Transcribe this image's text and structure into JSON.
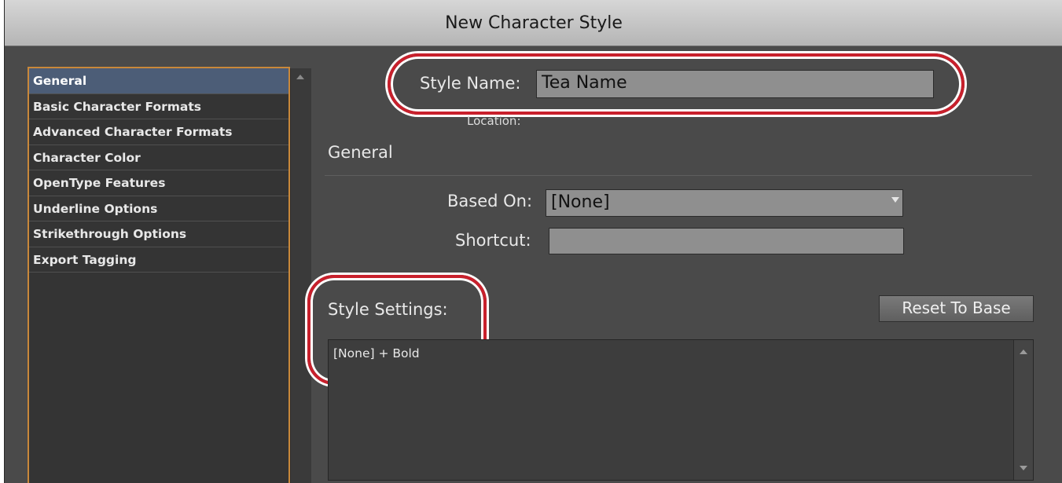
{
  "window": {
    "title": "New Character Style"
  },
  "sidebar": {
    "items": [
      {
        "label": "General"
      },
      {
        "label": "Basic Character Formats"
      },
      {
        "label": "Advanced Character Formats"
      },
      {
        "label": "Character Color"
      },
      {
        "label": "OpenType Features"
      },
      {
        "label": "Underline Options"
      },
      {
        "label": "Strikethrough Options"
      },
      {
        "label": "Export Tagging"
      }
    ],
    "selected_index": 0
  },
  "style_name": {
    "label": "Style Name:",
    "value": "Tea Name"
  },
  "location": {
    "label": "Location:"
  },
  "general": {
    "heading": "General",
    "based_on": {
      "label": "Based On:",
      "value": "[None]"
    },
    "shortcut": {
      "label": "Shortcut:",
      "value": ""
    }
  },
  "style_settings": {
    "label": "Style Settings:",
    "reset_button": "Reset To Base",
    "text": "[None] + Bold"
  },
  "colors": {
    "accent_highlight": "#c8202c",
    "selection": "#4c5d77",
    "list_border": "#c9883a"
  },
  "icons": [
    "chevron-down-icon",
    "scroll-up-icon",
    "scroll-down-icon"
  ]
}
